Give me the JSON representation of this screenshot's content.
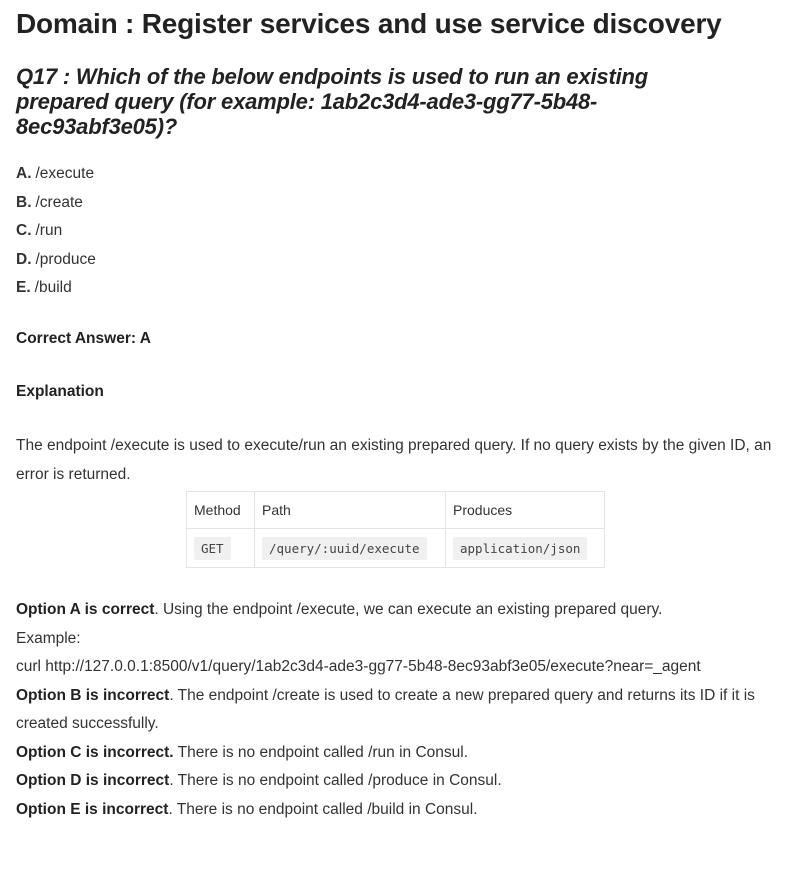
{
  "domain_title": "Domain : Register services and use service discovery",
  "question": "Q17 : Which of the below endpoints is used to run an existing prepared query (for example: 1ab2c3d4-ade3-gg77-5b48-8ec93abf3e05)?",
  "options": [
    {
      "letter": "A.",
      "text": "/execute"
    },
    {
      "letter": "B.",
      "text": "/create"
    },
    {
      "letter": "C.",
      "text": "/run"
    },
    {
      "letter": "D.",
      "text": "/produce"
    },
    {
      "letter": "E.",
      "text": "/build"
    }
  ],
  "correct_answer": "Correct Answer: A",
  "explanation_heading": "Explanation",
  "explanation_text": "The endpoint /execute is used to execute/run an existing prepared query. If no query exists by the given ID, an error is returned.",
  "api_table": {
    "headers": [
      "Method",
      "Path",
      "Produces"
    ],
    "row": [
      "GET",
      "/query/:uuid/execute",
      "application/json"
    ]
  },
  "answers": {
    "a_bold": "Option A is correct",
    "a_text": ". Using the endpoint /execute, we can execute an existing prepared query.",
    "example_label": "Example:",
    "example_command": "curl http://127.0.0.1:8500/v1/query/1ab2c3d4-ade3-gg77-5b48-8ec93abf3e05/execute?near=_agent",
    "b_bold": "Option B is incorrect",
    "b_text": ". The endpoint /create is used to create a new prepared query and returns its ID if it is created successfully.",
    "c_bold": "Option C is incorrect.",
    "c_text": " There is no endpoint called /run in Consul.",
    "d_bold": "Option D is incorrect",
    "d_text": ". There is no endpoint called /produce in Consul.",
    "e_bold": "Option E is incorrect",
    "e_text": ". There is no endpoint called /build in Consul."
  }
}
